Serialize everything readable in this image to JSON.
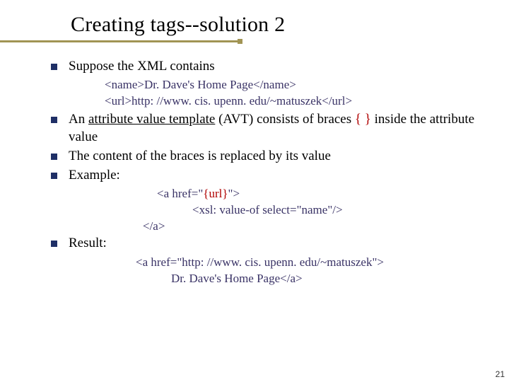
{
  "title": "Creating tags--solution 2",
  "b1": "Suppose the XML contains",
  "c1": "<name>Dr. Dave's Home Page</name>",
  "c2": "<url>http: //www. cis. upenn. edu/~matuszek</url>",
  "b2_pre": "An ",
  "b2_u": "attribute value template",
  "b2_post1": " (AVT) consists of braces ",
  "b2_lb": "{",
  "b2_rb": " }",
  "b2_post2": " inside the attribute value",
  "b3": "The content of the braces is replaced by its value",
  "b4": "Example:",
  "ex1a": "<a href=\"",
  "ex1b": "{url}",
  "ex1c": "\">",
  "ex2": "<xsl: value-of select=\"name\"/>",
  "ex3": "</a>",
  "b5": "Result:",
  "r1": "<a href=\"http: //www. cis. upenn. edu/~matuszek\">",
  "r2": "Dr. Dave's Home Page</a>",
  "page": "21"
}
